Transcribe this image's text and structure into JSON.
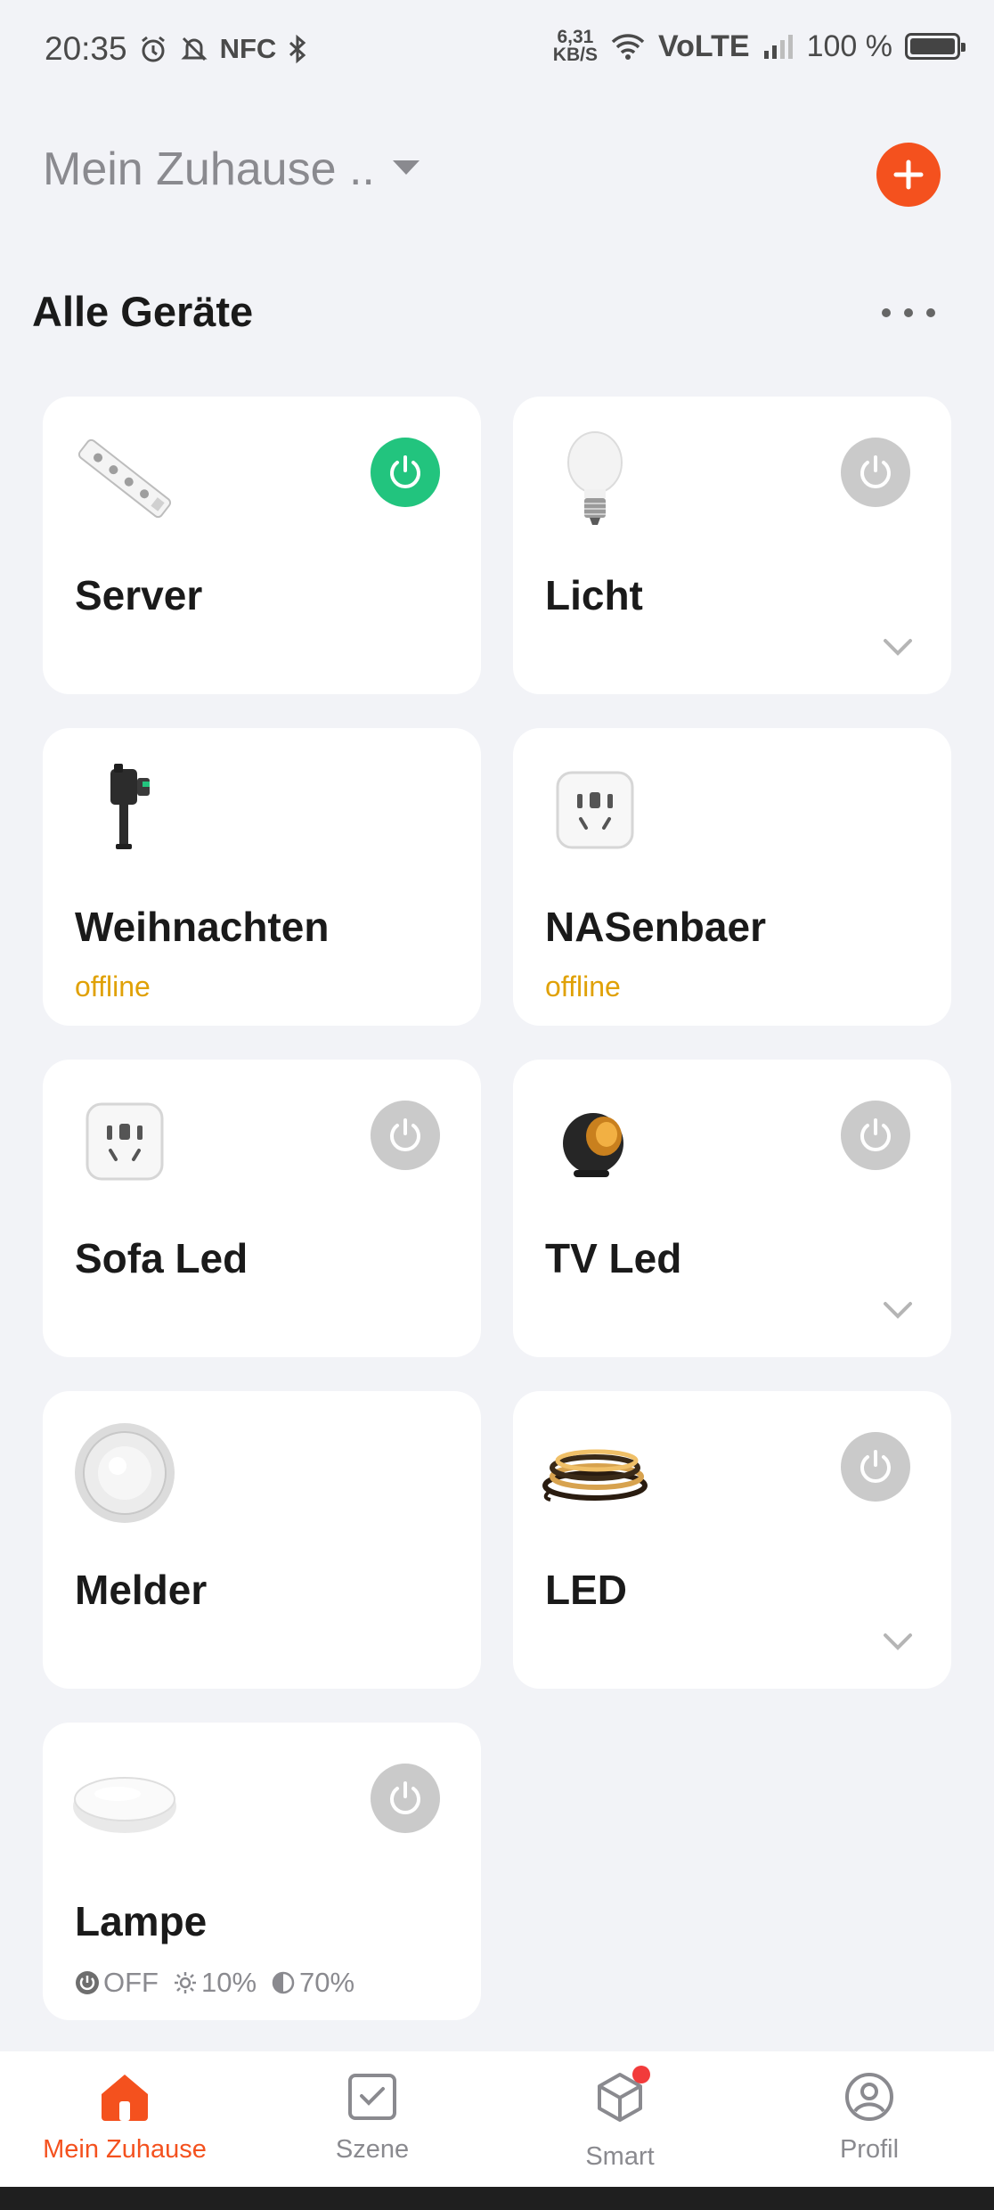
{
  "statusbar": {
    "time": "20:35",
    "nfc": "NFC",
    "speed_value": "6,31",
    "speed_unit": "KB/S",
    "network": "VoLTE",
    "battery": "100 %"
  },
  "header": {
    "home_title": "Mein Zuhause .."
  },
  "section": {
    "title": "Alle Geräte"
  },
  "devices": [
    {
      "name": "Server",
      "status": "",
      "icon": "power-strip-icon",
      "power": "on"
    },
    {
      "name": "Licht",
      "status": "",
      "icon": "bulb-icon",
      "power": "off",
      "expandable": true
    },
    {
      "name": "Weihnachten",
      "status": "offline",
      "icon": "outdoor-plug-icon"
    },
    {
      "name": "NASenbaer",
      "status": "offline",
      "icon": "smart-plug-icon"
    },
    {
      "name": "Sofa Led",
      "status": "",
      "icon": "smart-plug-icon",
      "power": "off"
    },
    {
      "name": "TV Led",
      "status": "",
      "icon": "ambient-lamp-icon",
      "power": "off",
      "expandable": true
    },
    {
      "name": "Melder",
      "status": "",
      "icon": "motion-sensor-icon"
    },
    {
      "name": "LED",
      "status": "",
      "icon": "led-strip-icon",
      "power": "off",
      "expandable": true
    },
    {
      "name": "Lampe",
      "status": "",
      "icon": "ceiling-lamp-icon",
      "power": "off"
    }
  ],
  "lampe_stats": {
    "power": "OFF",
    "brightness": "10%",
    "color_temp": "70%"
  },
  "nav": [
    {
      "label": "Mein Zuhause",
      "icon": "home-icon",
      "active": true
    },
    {
      "label": "Szene",
      "icon": "scene-checkbox-icon"
    },
    {
      "label": "Smart",
      "icon": "smart-cube-icon",
      "badge": true
    },
    {
      "label": "Profil",
      "icon": "profile-icon"
    }
  ],
  "colors": {
    "accent": "#f4511e",
    "power_on": "#22c47e",
    "power_off": "#cacaca",
    "offline": "#e0a106",
    "background": "#f2f3f7"
  }
}
